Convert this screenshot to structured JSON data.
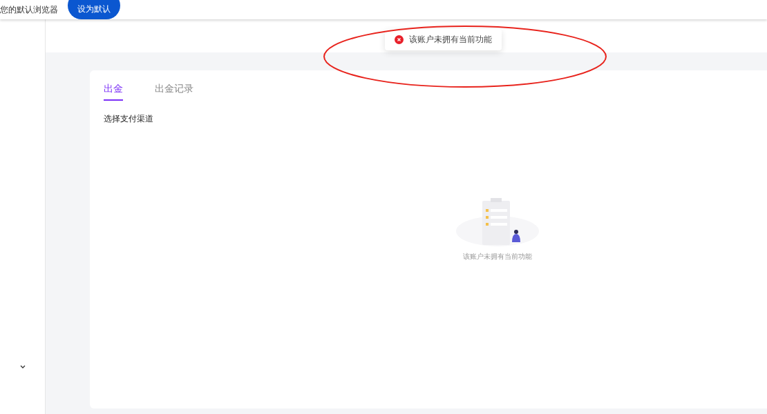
{
  "browser_banner": {
    "message": "您的默认浏览器",
    "button": "设为默认"
  },
  "toast": {
    "message": "该账户未拥有当前功能"
  },
  "tabs": [
    {
      "label": "出金",
      "selected": true
    },
    {
      "label": "出金记录",
      "selected": false
    }
  ],
  "section_title": "选择支付渠道",
  "empty_state": {
    "message": "该账户未拥有当前功能"
  },
  "annotation": {
    "color": "#e8231c"
  }
}
